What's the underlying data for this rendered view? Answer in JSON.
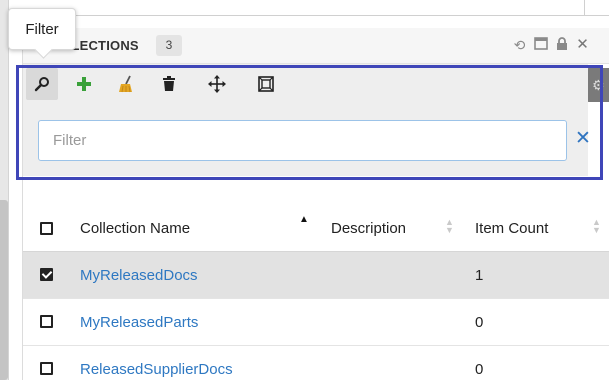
{
  "tooltip": {
    "text": "Filter"
  },
  "panel": {
    "title": "COLLECTIONS",
    "title_visible": "OLLECTIONS",
    "count": "3",
    "header_icons": [
      "refresh-icon",
      "maximize-icon",
      "lock-icon",
      "close-icon"
    ]
  },
  "toolbar": {
    "buttons": [
      {
        "name": "filter-button",
        "icon": "search-icon",
        "active": true
      },
      {
        "name": "add-button",
        "icon": "plus-icon",
        "color": "#3aa13a"
      },
      {
        "name": "clear-button",
        "icon": "broom-icon",
        "color": "#e3a623"
      },
      {
        "name": "delete-button",
        "icon": "trash-icon"
      },
      {
        "name": "move-button",
        "icon": "move-arrows-icon"
      },
      {
        "name": "fit-button",
        "icon": "fit-frame-icon"
      }
    ]
  },
  "filter": {
    "placeholder": "Filter",
    "value": ""
  },
  "table": {
    "columns": [
      "Collection Name",
      "Description",
      "Item Count"
    ],
    "rows": [
      {
        "name": "MyReleasedDocs",
        "description": "",
        "count": "1",
        "checked": true
      },
      {
        "name": "MyReleasedParts",
        "description": "",
        "count": "0",
        "checked": false
      },
      {
        "name": "ReleasedSupplierDocs",
        "description": "",
        "count": "0",
        "checked": false
      }
    ]
  },
  "colors": {
    "accent": "#2e78c2",
    "highlight_border": "#3f46b8",
    "selected_row": "#e2e2e2",
    "toolbar_bg": "#eeeeee"
  }
}
